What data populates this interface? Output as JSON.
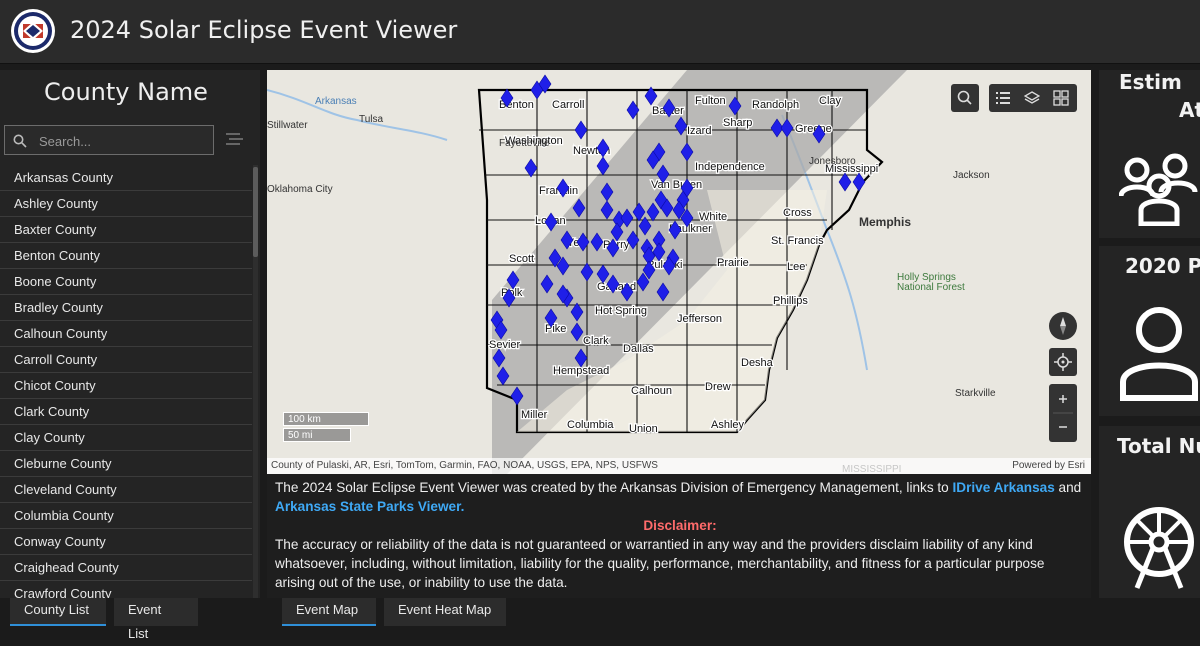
{
  "header": {
    "title": "2024 Solar Eclipse Event Viewer"
  },
  "county_list": {
    "title": "County Name",
    "search_placeholder": "Search...",
    "items": [
      "Arkansas County",
      "Ashley County",
      "Baxter County",
      "Benton County",
      "Boone County",
      "Bradley County",
      "Calhoun County",
      "Carroll County",
      "Chicot County",
      "Clark County",
      "Clay County",
      "Cleburne County",
      "Cleveland County",
      "Columbia County",
      "Conway County",
      "Craighead County",
      "Crawford County"
    ]
  },
  "map": {
    "attribution": "County of Pulaski, AR, Esri, TomTom, Garmin, FAO, NOAA, USGS, EPA, NPS, USFWS",
    "powered_by": "Powered by Esri",
    "scale_km": "100 km",
    "scale_mi": "50 mi",
    "county_labels": [
      "Benton",
      "Carroll",
      "Baxter",
      "Fulton",
      "Randolph",
      "Clay",
      "Washington",
      "Izard",
      "Sharp",
      "Greene",
      "Newton",
      "Independence",
      "Mississippi",
      "Franklin",
      "Van Buren",
      "Cross",
      "White",
      "Logan",
      "Faulkner",
      "St. Francis",
      "Yell",
      "Perry",
      "Pulaski",
      "Prairie",
      "Scott",
      "Lee",
      "Polk",
      "Garland",
      "Phillips",
      "Hot Spring",
      "Pike",
      "Jefferson",
      "Clark",
      "Dallas",
      "Sevier",
      "Desha",
      "Hempstead",
      "Calhoun",
      "Drew",
      "Miller",
      "Columbia",
      "Union",
      "Ashley"
    ],
    "place_labels": [
      "Tulsa",
      "Stillwater",
      "Fayetteville",
      "Jonesboro",
      "Jackson",
      "Memphis",
      "Holly Springs",
      "National Forest",
      "Starkville",
      "Oklahoma City",
      "MISSISSIPPI",
      "Arkansas"
    ],
    "colors": {
      "marker": "#1f1fe8",
      "eclipse_path": "#a9a9a9"
    }
  },
  "description": {
    "text_before": "The 2024 Solar Eclipse  Event Viewer was created by the Arkansas Division of Emergency Management, links to ",
    "link1": "IDrive Arkansas",
    "text_between": " and ",
    "link2": "Arkansas State Parks Viewer.",
    "disclaimer_title": "Disclaimer:",
    "disclaimer_text": "The accuracy or reliability of the data is not guaranteed or warrantied in any way and the providers disclaim liability of any kind whatsoever, including, without limitation, liability for the quality, performance, merchantability, and fitness for a particular purpose arising out of the use, or inability to use the data."
  },
  "tabs": {
    "county_list": "County List",
    "event_list": "Event List",
    "event_map": "Event Map",
    "event_heat_map": "Event Heat Map"
  },
  "right_cards": {
    "card1_title_line1": "Estim",
    "card1_title_line2": "At",
    "card2_title": "2020 P",
    "card3_title": "Total Nu"
  }
}
